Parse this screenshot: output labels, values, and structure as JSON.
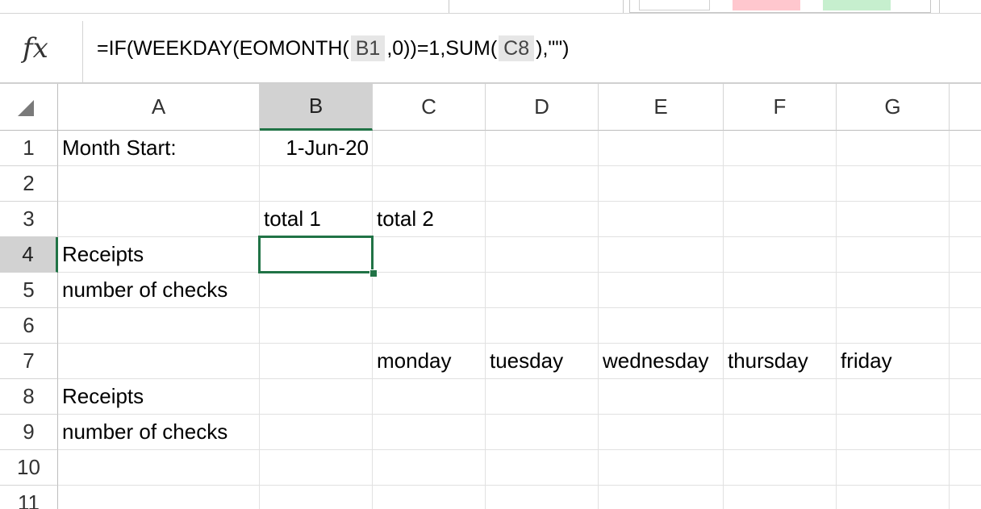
{
  "formula_bar": {
    "fx_label": "fx",
    "parts": [
      "=IF(WEEKDAY(EOMONTH(",
      "B1",
      ",0))=1,SUM(",
      "C8",
      "),\"\")"
    ]
  },
  "sheet": {
    "columns": [
      "A",
      "B",
      "C",
      "D",
      "E",
      "F",
      "G"
    ],
    "rows": [
      "1",
      "2",
      "3",
      "4",
      "5",
      "6",
      "7",
      "8",
      "9",
      "10",
      "11"
    ],
    "active_cell": "B4",
    "cells": {
      "A1": "Month Start:",
      "B1": "1-Jun-20",
      "B3": "total 1",
      "C3": "total 2",
      "A4": "Receipts",
      "A5": "number of checks",
      "C7": "monday",
      "D7": "tuesday",
      "E7": "wednesday",
      "F7": "thursday",
      "G7": "friday",
      "A8": "Receipts",
      "A9": "number of checks"
    }
  },
  "colors": {
    "accent": "#217346",
    "header_active": "#d2d2d2",
    "style_bad": "#ffc7ce",
    "style_good": "#c6efce"
  }
}
